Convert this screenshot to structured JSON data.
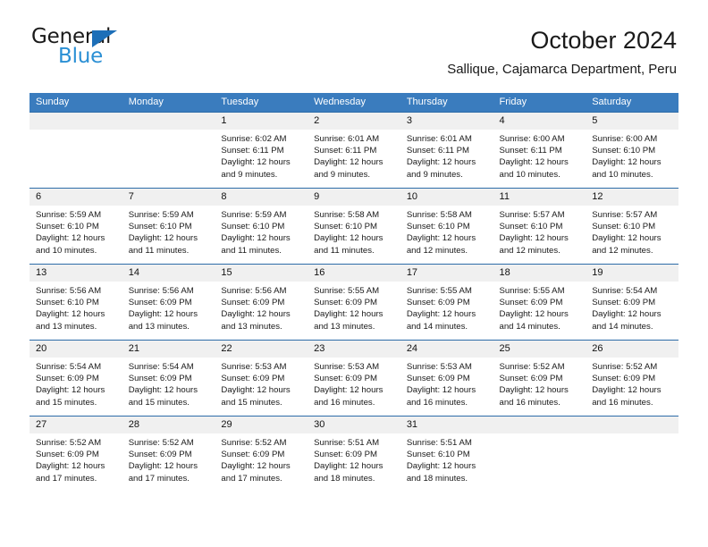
{
  "brand": {
    "name_top": "General",
    "name_bottom": "Blue",
    "accent_color": "#1d6fb8",
    "accent_color_light": "#2a8fd4"
  },
  "header": {
    "title": "October 2024",
    "subtitle": "Sallique, Cajamarca Department, Peru"
  },
  "calendar": {
    "header_bg": "#3a7cbe",
    "row_border_color": "#2d6ca8",
    "daynum_bg": "#f0f0f0",
    "weekdays": [
      "Sunday",
      "Monday",
      "Tuesday",
      "Wednesday",
      "Thursday",
      "Friday",
      "Saturday"
    ],
    "weeks": [
      [
        {
          "day": "",
          "lines": []
        },
        {
          "day": "",
          "lines": []
        },
        {
          "day": "1",
          "lines": [
            "Sunrise: 6:02 AM",
            "Sunset: 6:11 PM",
            "Daylight: 12 hours",
            "and 9 minutes."
          ]
        },
        {
          "day": "2",
          "lines": [
            "Sunrise: 6:01 AM",
            "Sunset: 6:11 PM",
            "Daylight: 12 hours",
            "and 9 minutes."
          ]
        },
        {
          "day": "3",
          "lines": [
            "Sunrise: 6:01 AM",
            "Sunset: 6:11 PM",
            "Daylight: 12 hours",
            "and 9 minutes."
          ]
        },
        {
          "day": "4",
          "lines": [
            "Sunrise: 6:00 AM",
            "Sunset: 6:11 PM",
            "Daylight: 12 hours",
            "and 10 minutes."
          ]
        },
        {
          "day": "5",
          "lines": [
            "Sunrise: 6:00 AM",
            "Sunset: 6:10 PM",
            "Daylight: 12 hours",
            "and 10 minutes."
          ]
        }
      ],
      [
        {
          "day": "6",
          "lines": [
            "Sunrise: 5:59 AM",
            "Sunset: 6:10 PM",
            "Daylight: 12 hours",
            "and 10 minutes."
          ]
        },
        {
          "day": "7",
          "lines": [
            "Sunrise: 5:59 AM",
            "Sunset: 6:10 PM",
            "Daylight: 12 hours",
            "and 11 minutes."
          ]
        },
        {
          "day": "8",
          "lines": [
            "Sunrise: 5:59 AM",
            "Sunset: 6:10 PM",
            "Daylight: 12 hours",
            "and 11 minutes."
          ]
        },
        {
          "day": "9",
          "lines": [
            "Sunrise: 5:58 AM",
            "Sunset: 6:10 PM",
            "Daylight: 12 hours",
            "and 11 minutes."
          ]
        },
        {
          "day": "10",
          "lines": [
            "Sunrise: 5:58 AM",
            "Sunset: 6:10 PM",
            "Daylight: 12 hours",
            "and 12 minutes."
          ]
        },
        {
          "day": "11",
          "lines": [
            "Sunrise: 5:57 AM",
            "Sunset: 6:10 PM",
            "Daylight: 12 hours",
            "and 12 minutes."
          ]
        },
        {
          "day": "12",
          "lines": [
            "Sunrise: 5:57 AM",
            "Sunset: 6:10 PM",
            "Daylight: 12 hours",
            "and 12 minutes."
          ]
        }
      ],
      [
        {
          "day": "13",
          "lines": [
            "Sunrise: 5:56 AM",
            "Sunset: 6:10 PM",
            "Daylight: 12 hours",
            "and 13 minutes."
          ]
        },
        {
          "day": "14",
          "lines": [
            "Sunrise: 5:56 AM",
            "Sunset: 6:09 PM",
            "Daylight: 12 hours",
            "and 13 minutes."
          ]
        },
        {
          "day": "15",
          "lines": [
            "Sunrise: 5:56 AM",
            "Sunset: 6:09 PM",
            "Daylight: 12 hours",
            "and 13 minutes."
          ]
        },
        {
          "day": "16",
          "lines": [
            "Sunrise: 5:55 AM",
            "Sunset: 6:09 PM",
            "Daylight: 12 hours",
            "and 13 minutes."
          ]
        },
        {
          "day": "17",
          "lines": [
            "Sunrise: 5:55 AM",
            "Sunset: 6:09 PM",
            "Daylight: 12 hours",
            "and 14 minutes."
          ]
        },
        {
          "day": "18",
          "lines": [
            "Sunrise: 5:55 AM",
            "Sunset: 6:09 PM",
            "Daylight: 12 hours",
            "and 14 minutes."
          ]
        },
        {
          "day": "19",
          "lines": [
            "Sunrise: 5:54 AM",
            "Sunset: 6:09 PM",
            "Daylight: 12 hours",
            "and 14 minutes."
          ]
        }
      ],
      [
        {
          "day": "20",
          "lines": [
            "Sunrise: 5:54 AM",
            "Sunset: 6:09 PM",
            "Daylight: 12 hours",
            "and 15 minutes."
          ]
        },
        {
          "day": "21",
          "lines": [
            "Sunrise: 5:54 AM",
            "Sunset: 6:09 PM",
            "Daylight: 12 hours",
            "and 15 minutes."
          ]
        },
        {
          "day": "22",
          "lines": [
            "Sunrise: 5:53 AM",
            "Sunset: 6:09 PM",
            "Daylight: 12 hours",
            "and 15 minutes."
          ]
        },
        {
          "day": "23",
          "lines": [
            "Sunrise: 5:53 AM",
            "Sunset: 6:09 PM",
            "Daylight: 12 hours",
            "and 16 minutes."
          ]
        },
        {
          "day": "24",
          "lines": [
            "Sunrise: 5:53 AM",
            "Sunset: 6:09 PM",
            "Daylight: 12 hours",
            "and 16 minutes."
          ]
        },
        {
          "day": "25",
          "lines": [
            "Sunrise: 5:52 AM",
            "Sunset: 6:09 PM",
            "Daylight: 12 hours",
            "and 16 minutes."
          ]
        },
        {
          "day": "26",
          "lines": [
            "Sunrise: 5:52 AM",
            "Sunset: 6:09 PM",
            "Daylight: 12 hours",
            "and 16 minutes."
          ]
        }
      ],
      [
        {
          "day": "27",
          "lines": [
            "Sunrise: 5:52 AM",
            "Sunset: 6:09 PM",
            "Daylight: 12 hours",
            "and 17 minutes."
          ]
        },
        {
          "day": "28",
          "lines": [
            "Sunrise: 5:52 AM",
            "Sunset: 6:09 PM",
            "Daylight: 12 hours",
            "and 17 minutes."
          ]
        },
        {
          "day": "29",
          "lines": [
            "Sunrise: 5:52 AM",
            "Sunset: 6:09 PM",
            "Daylight: 12 hours",
            "and 17 minutes."
          ]
        },
        {
          "day": "30",
          "lines": [
            "Sunrise: 5:51 AM",
            "Sunset: 6:09 PM",
            "Daylight: 12 hours",
            "and 18 minutes."
          ]
        },
        {
          "day": "31",
          "lines": [
            "Sunrise: 5:51 AM",
            "Sunset: 6:10 PM",
            "Daylight: 12 hours",
            "and 18 minutes."
          ]
        },
        {
          "day": "",
          "lines": []
        },
        {
          "day": "",
          "lines": []
        }
      ]
    ]
  }
}
